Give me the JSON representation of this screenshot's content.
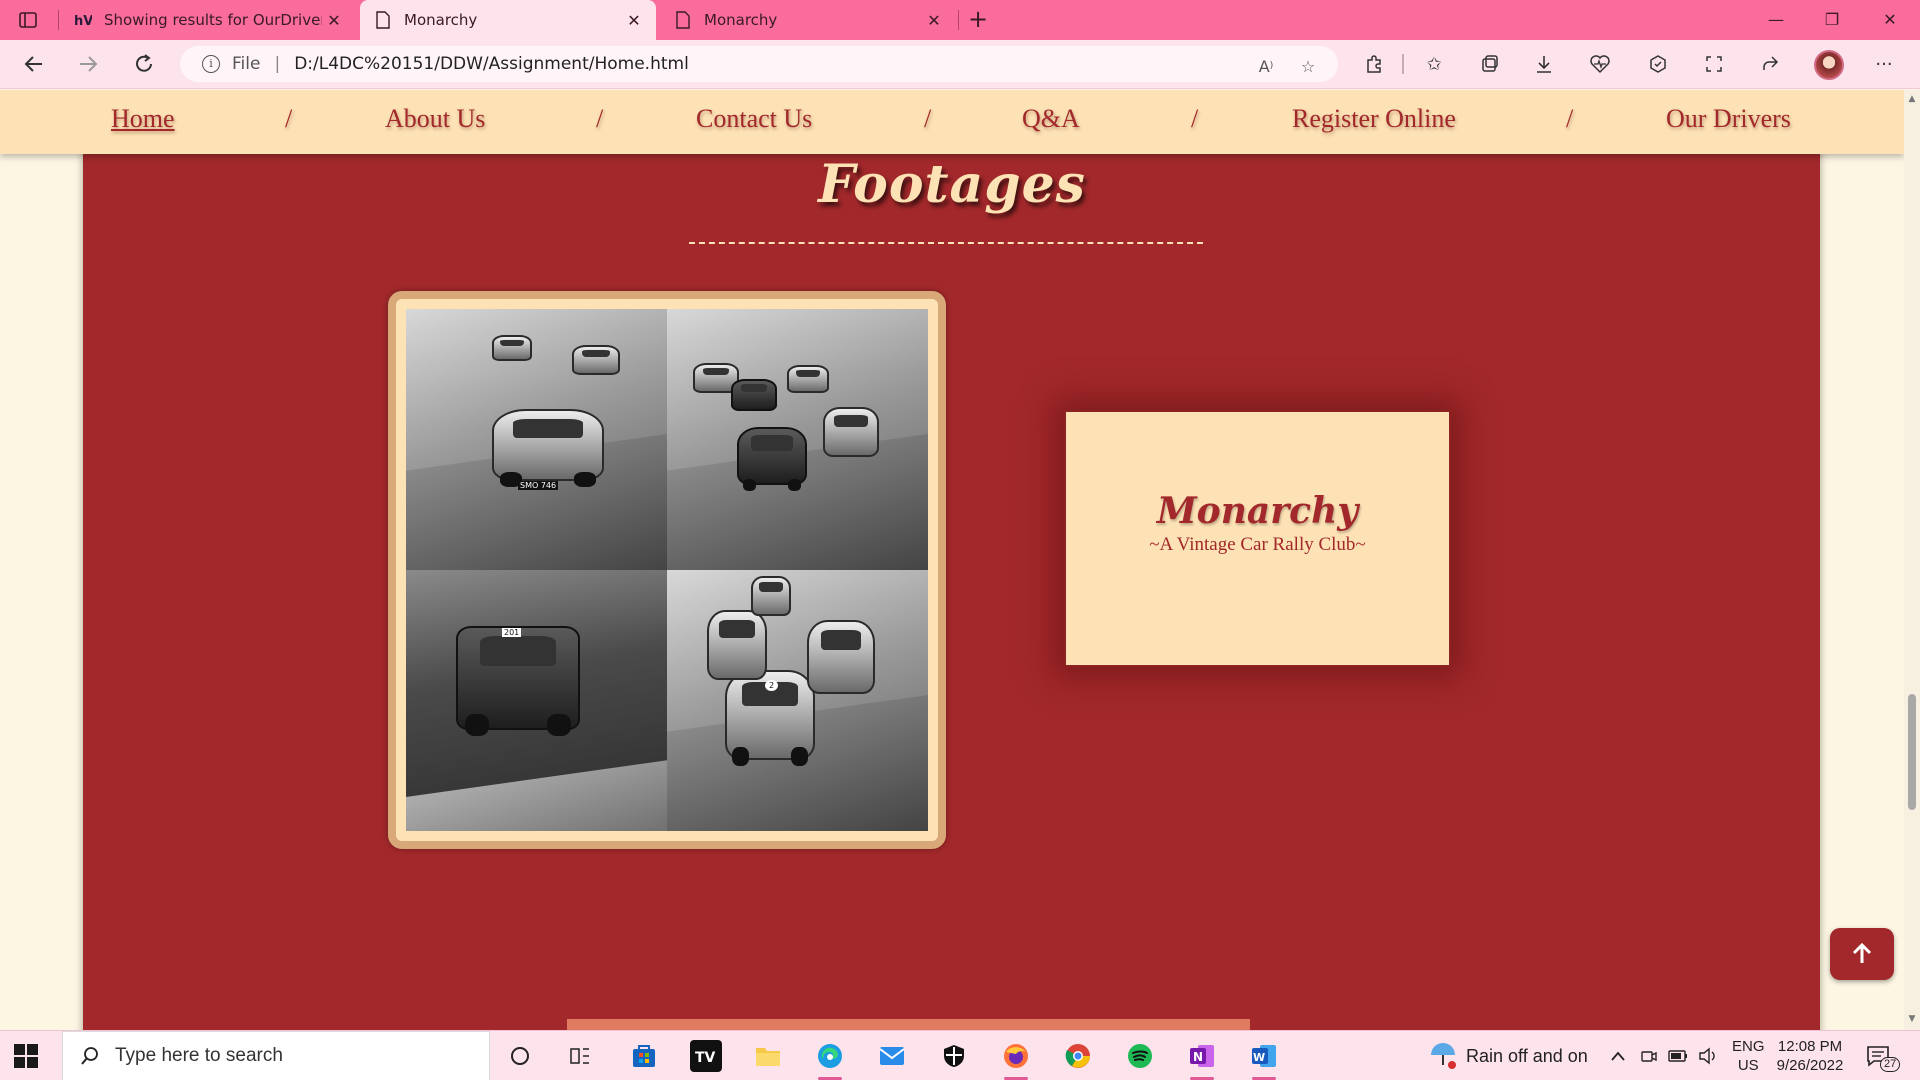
{
  "browser": {
    "tabs": [
      {
        "title": "Showing results for OurDrivers.h",
        "icon": "html-validator-icon"
      },
      {
        "title": "Monarchy",
        "icon": "page-icon",
        "active": true
      },
      {
        "title": "Monarchy",
        "icon": "page-icon"
      }
    ],
    "address": {
      "scheme_label": "File",
      "url": "D:/L4DC%20151/DDW/Assignment/Home.html"
    }
  },
  "site": {
    "nav": [
      {
        "label": "Home",
        "active": true
      },
      {
        "label": "About Us"
      },
      {
        "label": "Contact Us"
      },
      {
        "label": "Q&A"
      },
      {
        "label": "Register Online"
      },
      {
        "label": "Our Drivers"
      }
    ],
    "separator": "/",
    "section_title": "Footages",
    "club": {
      "name": "Monarchy",
      "tagline": "~A Vintage Car Rally Club~"
    },
    "photos": [
      {
        "alt": "vintage racing car on track",
        "plate": "SMO 746"
      },
      {
        "alt": "pack of vintage race cars"
      },
      {
        "alt": "rally car on dirt road",
        "plate": "201"
      },
      {
        "alt": "vintage cars racing in corner",
        "plate": "2"
      }
    ]
  },
  "taskbar": {
    "search_placeholder": "Type here to search",
    "weather": "Rain off and on",
    "lang_primary": "ENG",
    "lang_secondary": "US",
    "time": "12:08 PM",
    "date": "9/26/2022",
    "notification_count": "27"
  },
  "colors": {
    "tab_strip": "#f96c9c",
    "nav_bg": "#fde2b5",
    "brand_red": "#a2282b",
    "page_bg": "#fdf6e3"
  }
}
